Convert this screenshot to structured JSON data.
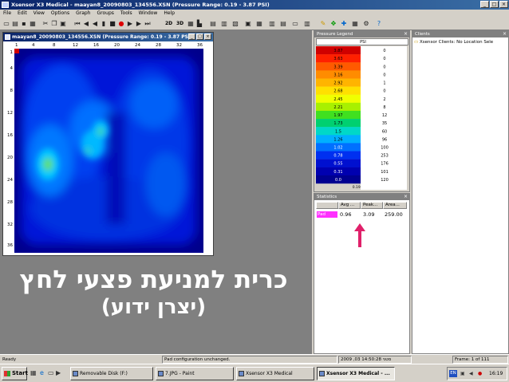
{
  "window": {
    "title": "Xsensor X3 Medical - maayan8_20090803_134556.XSN (Pressure Range: 0.19 - 3.87 PSI)"
  },
  "menu": [
    "File",
    "Edit",
    "View",
    "Options",
    "Graph",
    "Groups",
    "Tools",
    "Window",
    "Help"
  ],
  "toolbar": {
    "view_2d": "2D",
    "view_3d": "3D"
  },
  "child": {
    "title": "maayan8_20090803_134556.XSN (Pressure Range: 0.19 - 3.87 PSI)",
    "x_ticks": [
      "1",
      "4",
      "8",
      "12",
      "16",
      "20",
      "24",
      "28",
      "32",
      "36"
    ],
    "y_ticks": [
      "1",
      "4",
      "8",
      "12",
      "16",
      "20",
      "24",
      "28",
      "32",
      "36"
    ]
  },
  "legend": {
    "title": "Pressure Legend",
    "unit": "PSI",
    "range_label": "0.19 - 3.87",
    "levels": [
      {
        "value": "3.87",
        "count": "0",
        "color": "#d00000"
      },
      {
        "value": "3.63",
        "count": "0",
        "color": "#ff2000"
      },
      {
        "value": "3.39",
        "count": "0",
        "color": "#ff5a00"
      },
      {
        "value": "3.16",
        "count": "0",
        "color": "#ff8c00"
      },
      {
        "value": "2.92",
        "count": "1",
        "color": "#ffb400"
      },
      {
        "value": "2.68",
        "count": "0",
        "color": "#ffe000"
      },
      {
        "value": "2.45",
        "count": "2",
        "color": "#f0ff00"
      },
      {
        "value": "2.21",
        "count": "8",
        "color": "#a8f000"
      },
      {
        "value": "1.97",
        "count": "12",
        "color": "#40e020"
      },
      {
        "value": "1.73",
        "count": "35",
        "color": "#00d070"
      },
      {
        "value": "1.5",
        "count": "60",
        "color": "#00d8c8"
      },
      {
        "value": "1.26",
        "count": "96",
        "color": "#00b0ff"
      },
      {
        "value": "1.02",
        "count": "100",
        "color": "#0070ff"
      },
      {
        "value": "0.78",
        "count": "253",
        "color": "#0030f0"
      },
      {
        "value": "0.55",
        "count": "176",
        "color": "#0010d0"
      },
      {
        "value": "0.31",
        "count": "101",
        "color": "#0000b0"
      },
      {
        "value": "0.0",
        "count": "120",
        "color": "#000090"
      }
    ]
  },
  "stats": {
    "title": "Statistics",
    "headers": [
      "Avg ...",
      "Peak...",
      "Area..."
    ],
    "row": {
      "label": "Pad",
      "avg": "0.96",
      "peak": "3.09",
      "area": "259.00"
    }
  },
  "clients": {
    "title": "Clients",
    "item": "Xsensor Clients: No Location Sele"
  },
  "status": {
    "ready": "Ready",
    "message": "Pad configuration unchanged.",
    "datetime": "2009 ,03 סטני 14:50:28",
    "frame": "Frame: 1 of 111"
  },
  "taskbar": {
    "start": "Start",
    "items": [
      "Removable Disk (F:)",
      "7.JPG - Paint",
      "Xsensor X3 Medical",
      "Xsensor X3 Medical - ..."
    ],
    "lang": "EN",
    "clock": "16:19"
  },
  "caption": {
    "line1": "כרית למניעת פצעי לחץ",
    "line2": "(יצרן ידוע)"
  },
  "colors": {
    "titlebar": "#0a246a",
    "accent_arrow": "#e0206a",
    "workspace": "#808080"
  }
}
